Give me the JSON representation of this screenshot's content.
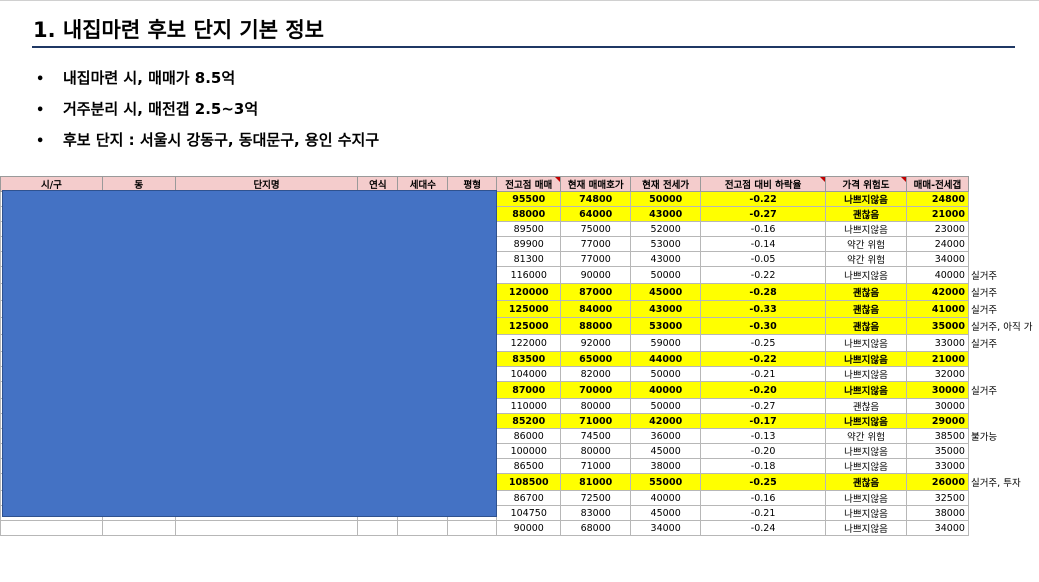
{
  "title": "1. 내집마련 후보 단지 기본 정보",
  "bullets": [
    "내집마련 시, 매매가 8.5억",
    "거주분리 시, 매전갭 2.5~3억",
    "후보 단지 : 서울시 강동구, 동대문구, 용인 수지구"
  ],
  "bullet_symbol": "•",
  "colors": {
    "highlight": "#ffff00",
    "header": "#f4cccc",
    "mask": "#4472c4",
    "rule": "#1f3864"
  },
  "table": {
    "headers": [
      "시/구",
      "동",
      "단지명",
      "연식",
      "세대수",
      "평형",
      "전고점 매매",
      "현재 매매호가",
      "현재 전세가",
      "전고점 대비 하락율",
      "가격 위험도",
      "매매-전세갭"
    ],
    "rows": [
      {
        "peak": "95500",
        "ask": "74800",
        "jeonse": "50000",
        "drop": "-0.22",
        "risk": "나쁘지않음",
        "gap": "24800",
        "note": "",
        "hl": true
      },
      {
        "peak": "88000",
        "ask": "64000",
        "jeonse": "43000",
        "drop": "-0.27",
        "risk": "괜찮음",
        "gap": "21000",
        "note": "",
        "hl": true
      },
      {
        "peak": "89500",
        "ask": "75000",
        "jeonse": "52000",
        "drop": "-0.16",
        "risk": "나쁘지않음",
        "gap": "23000",
        "note": "",
        "hl": false
      },
      {
        "peak": "89900",
        "ask": "77000",
        "jeonse": "53000",
        "drop": "-0.14",
        "risk": "약간 위험",
        "gap": "24000",
        "note": "",
        "hl": false
      },
      {
        "peak": "81300",
        "ask": "77000",
        "jeonse": "43000",
        "drop": "-0.05",
        "risk": "약간 위험",
        "gap": "34000",
        "note": "",
        "hl": false
      },
      {
        "peak": "116000",
        "ask": "90000",
        "jeonse": "50000",
        "drop": "-0.22",
        "risk": "나쁘지않음",
        "gap": "40000",
        "note": "실거주",
        "hl": false,
        "tall": true
      },
      {
        "peak": "120000",
        "ask": "87000",
        "jeonse": "45000",
        "drop": "-0.28",
        "risk": "괜찮음",
        "gap": "42000",
        "note": "실거주",
        "hl": true,
        "tall": true
      },
      {
        "peak": "125000",
        "ask": "84000",
        "jeonse": "43000",
        "drop": "-0.33",
        "risk": "괜찮음",
        "gap": "41000",
        "note": "실거주",
        "hl": true,
        "tall": true
      },
      {
        "peak": "125000",
        "ask": "88000",
        "jeonse": "53000",
        "drop": "-0.30",
        "risk": "괜찮음",
        "gap": "35000",
        "note": "실거주, 아직 가",
        "hl": true,
        "tall": true
      },
      {
        "peak": "122000",
        "ask": "92000",
        "jeonse": "59000",
        "drop": "-0.25",
        "risk": "나쁘지않음",
        "gap": "33000",
        "note": "실거주",
        "hl": false,
        "tall": true
      },
      {
        "peak": "83500",
        "ask": "65000",
        "jeonse": "44000",
        "drop": "-0.22",
        "risk": "나쁘지않음",
        "gap": "21000",
        "note": "",
        "hl": true
      },
      {
        "peak": "104000",
        "ask": "82000",
        "jeonse": "50000",
        "drop": "-0.21",
        "risk": "나쁘지않음",
        "gap": "32000",
        "note": "",
        "hl": false
      },
      {
        "peak": "87000",
        "ask": "70000",
        "jeonse": "40000",
        "drop": "-0.20",
        "risk": "나쁘지않음",
        "gap": "30000",
        "note": "실거주",
        "hl": true,
        "tall": true
      },
      {
        "peak": "110000",
        "ask": "80000",
        "jeonse": "50000",
        "drop": "-0.27",
        "risk": "괜찮음",
        "gap": "30000",
        "note": "",
        "hl": false
      },
      {
        "peak": "85200",
        "ask": "71000",
        "jeonse": "42000",
        "drop": "-0.17",
        "risk": "나쁘지않음",
        "gap": "29000",
        "note": "",
        "hl": true
      },
      {
        "peak": "86000",
        "ask": "74500",
        "jeonse": "36000",
        "drop": "-0.13",
        "risk": "약간 위험",
        "gap": "38500",
        "note": "불가능",
        "hl": false
      },
      {
        "peak": "100000",
        "ask": "80000",
        "jeonse": "45000",
        "drop": "-0.20",
        "risk": "나쁘지않음",
        "gap": "35000",
        "note": "",
        "hl": false
      },
      {
        "peak": "86500",
        "ask": "71000",
        "jeonse": "38000",
        "drop": "-0.18",
        "risk": "나쁘지않음",
        "gap": "33000",
        "note": "",
        "hl": false
      },
      {
        "peak": "108500",
        "ask": "81000",
        "jeonse": "55000",
        "drop": "-0.25",
        "risk": "괜찮음",
        "gap": "26000",
        "note": "실거주, 투자",
        "hl": true,
        "tall": true
      },
      {
        "peak": "86700",
        "ask": "72500",
        "jeonse": "40000",
        "drop": "-0.16",
        "risk": "나쁘지않음",
        "gap": "32500",
        "note": "",
        "hl": false
      },
      {
        "peak": "104750",
        "ask": "83000",
        "jeonse": "45000",
        "drop": "-0.21",
        "risk": "나쁘지않음",
        "gap": "38000",
        "note": "",
        "hl": false
      },
      {
        "peak": "90000",
        "ask": "68000",
        "jeonse": "34000",
        "drop": "-0.24",
        "risk": "나쁘지않음",
        "gap": "34000",
        "note": "",
        "hl": false
      }
    ]
  }
}
